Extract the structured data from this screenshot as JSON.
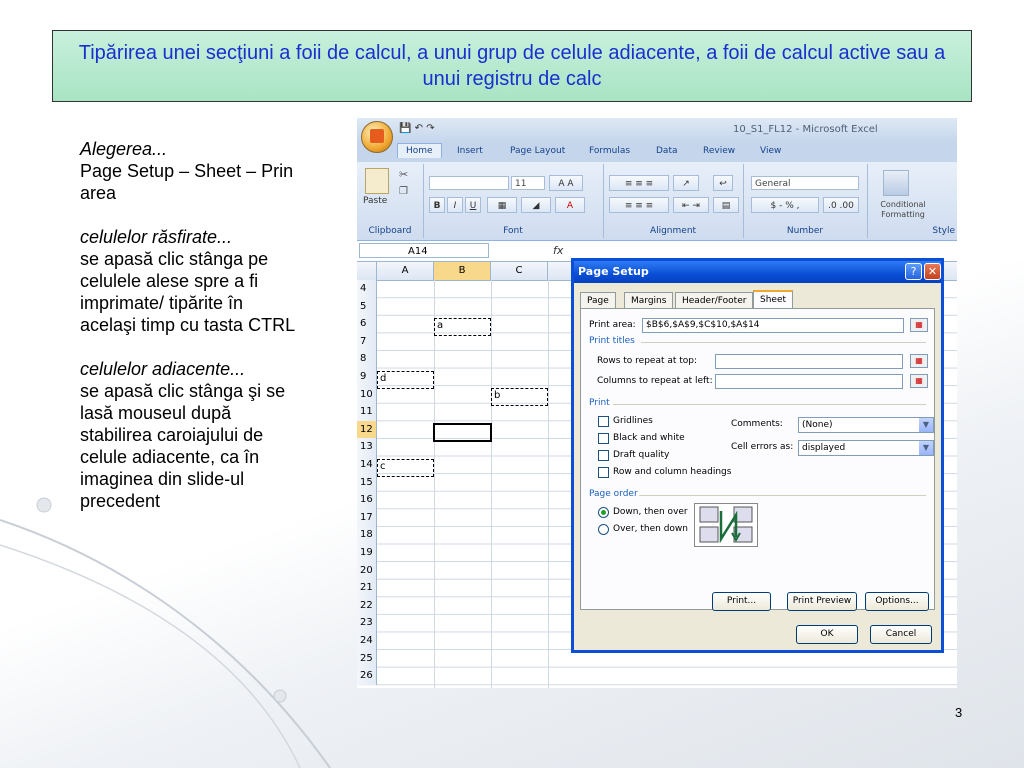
{
  "slide": {
    "title": "Tipărirea unei secţiuni a foii de calcul, a unui grup de celule adiacente, a foii de calcul active sau a unui registru de calc",
    "page_number": "3",
    "left_text": {
      "p1_italic": "Alegerea...",
      "p1_body": "Page Setup – Sheet – Prin area",
      "p2_italic": "celulelor răsfirate...",
      "p2_body": "se apasă clic stânga pe celulele alese spre a fi imprimate/ tipărite în acelaşi timp cu tasta CTRL",
      "p3_italic": "celulelor adiacente...",
      "p3_body": "se apasă clic stânga şi se lasă mouseul după stabilirea caroiajului de celule adiacente, ca în imaginea din slide-ul precedent"
    }
  },
  "excel": {
    "window_title": "10_S1_FL12 - Microsoft Excel",
    "ribbon_tabs": [
      "Home",
      "Insert",
      "Page Layout",
      "Formulas",
      "Data",
      "Review",
      "View"
    ],
    "groups": {
      "clipboard": "Clipboard",
      "font": "Font",
      "alignment": "Alignment",
      "number": "Number",
      "styles": "Style"
    },
    "paste_label": "Paste",
    "font_size": "11",
    "number_format": "General",
    "conditional_formatting": "Conditional Formatting",
    "name_box": "A14",
    "fx": "fx",
    "columns": [
      "A",
      "B",
      "C"
    ],
    "rows": [
      "4",
      "5",
      "6",
      "7",
      "8",
      "9",
      "10",
      "11",
      "12",
      "13",
      "14",
      "15",
      "16",
      "17",
      "18",
      "19",
      "20",
      "21",
      "22",
      "23",
      "24",
      "25",
      "26"
    ],
    "cell_labels": {
      "a": "a",
      "b": "b",
      "c": "c",
      "d": "d"
    }
  },
  "page_setup": {
    "title": "Page Setup",
    "help": "?",
    "close": "✕",
    "tabs": [
      "Page",
      "Margins",
      "Header/Footer",
      "Sheet"
    ],
    "active_tab": "Sheet",
    "print_area_label": "Print area:",
    "print_area_value": "$B$6,$A$9,$C$10,$A$14",
    "print_titles": "Print titles",
    "rows_to_repeat": "Rows to repeat at top:",
    "cols_to_repeat": "Columns to repeat at left:",
    "print_section": "Print",
    "gridlines": "Gridlines",
    "black_white": "Black and white",
    "draft_quality": "Draft quality",
    "row_col_headings": "Row and column headings",
    "comments_label": "Comments:",
    "comments_value": "(None)",
    "cell_errors_label": "Cell errors as:",
    "cell_errors_value": "displayed",
    "page_order": "Page order",
    "down_then_over": "Down, then over",
    "over_then_down": "Over, then down",
    "print_btn": "Print...",
    "preview_btn": "Print Preview",
    "options_btn": "Options...",
    "ok_btn": "OK",
    "cancel_btn": "Cancel"
  }
}
